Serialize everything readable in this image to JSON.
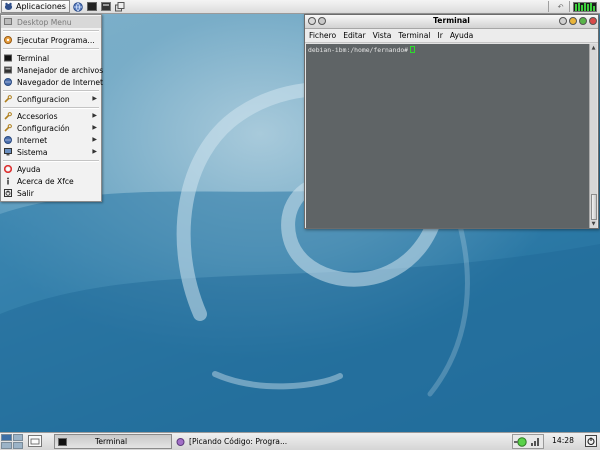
{
  "top_panel": {
    "apps_button_label": "Aplicaciones"
  },
  "app_menu": {
    "header": "Desktop Menu",
    "items": [
      {
        "label": "Ejecutar Programa...",
        "icon": "run-icon"
      },
      {
        "label": "Terminal",
        "icon": "terminal-icon"
      },
      {
        "label": "Manejador de archivos",
        "icon": "file-manager-icon"
      },
      {
        "label": "Navegador de Internet",
        "icon": "globe-icon"
      },
      {
        "label": "Configuracion",
        "icon": "wrench-icon",
        "submenu": true
      },
      {
        "label": "Accesorios",
        "icon": "wrench-icon",
        "submenu": true
      },
      {
        "label": "Configuración",
        "icon": "wrench-icon",
        "submenu": true
      },
      {
        "label": "Internet",
        "icon": "globe-icon",
        "submenu": true
      },
      {
        "label": "Sistema",
        "icon": "monitor-icon",
        "submenu": true
      },
      {
        "label": "Ayuda",
        "icon": "help-lifebuoy-icon"
      },
      {
        "label": "Acerca de Xfce",
        "icon": "info-icon"
      },
      {
        "label": "Salir",
        "icon": "logout-icon"
      }
    ]
  },
  "terminal_window": {
    "title": "Terminal",
    "menu": [
      "Fichero",
      "Editar",
      "Vista",
      "Terminal",
      "Ir",
      "Ayuda"
    ],
    "prompt": "debian-ibm:/home/fernando#"
  },
  "bottom_panel": {
    "tasks": [
      {
        "label": "Terminal",
        "active": true
      },
      {
        "label": "[Picando Código: Progra...",
        "active": false
      }
    ],
    "clock": "14:28"
  },
  "colors": {
    "desktop": "#2f7fa8",
    "terminal_bg": "#5f6466",
    "cursor": "#2ddc2d",
    "close": "#d84a4a",
    "minimize": "#e8b43a",
    "maximize": "#5ab54a"
  }
}
